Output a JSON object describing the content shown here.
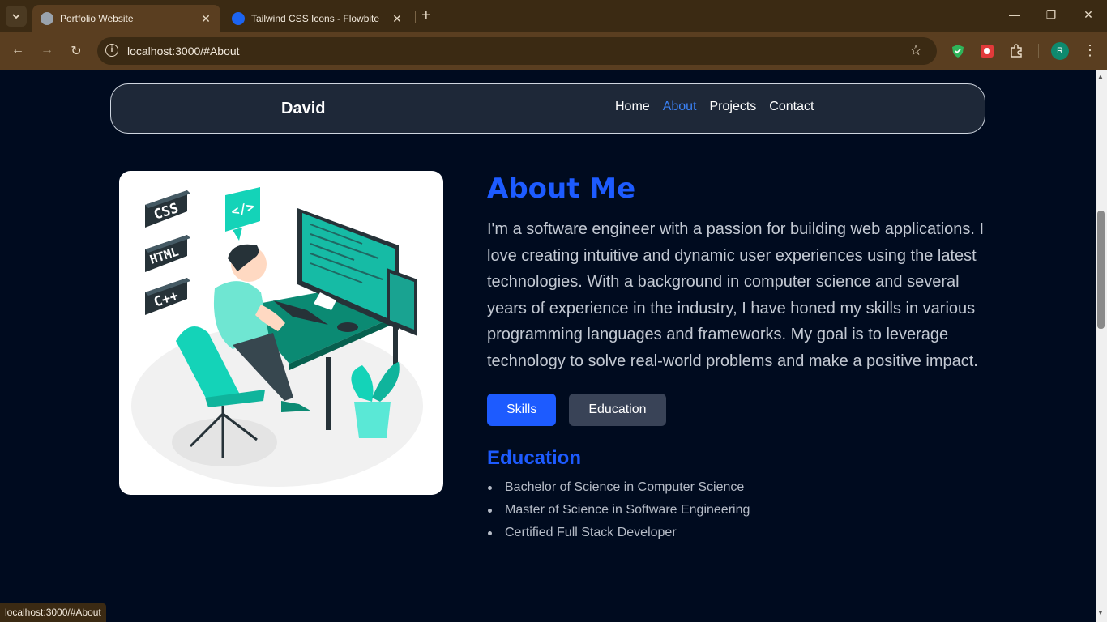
{
  "browser": {
    "tabs": [
      {
        "title": "Portfolio Website",
        "active": true
      },
      {
        "title": "Tailwind CSS Icons - Flowbite",
        "active": false
      }
    ],
    "address": "localhost:3000/#About",
    "status_url": "localhost:3000/#About",
    "profile_initial": "R"
  },
  "navbar": {
    "brand": "David",
    "links": [
      {
        "label": "Home",
        "active": false
      },
      {
        "label": "About",
        "active": true
      },
      {
        "label": "Projects",
        "active": false
      },
      {
        "label": "Contact",
        "active": false
      }
    ]
  },
  "about": {
    "title": "About Me",
    "description": "I'm a software engineer with a passion for building web applications. I love creating intuitive and dynamic user experiences using the latest technologies. With a background in computer science and several years of experience in the industry, I have honed my skills in various programming languages and frameworks. My goal is to leverage technology to solve real-world problems and make a positive impact.",
    "tabs": [
      {
        "label": "Skills",
        "active": true
      },
      {
        "label": "Education",
        "active": false
      }
    ],
    "section_title": "Education",
    "items": [
      "Bachelor of Science in Computer Science",
      "Master of Science in Software Engineering",
      "Certified Full Stack Developer"
    ]
  },
  "illustration": {
    "labels": [
      "CSS",
      "HTML",
      "C++",
      "</>"
    ]
  },
  "colors": {
    "accent": "#1d5bff",
    "page_bg": "#000b1f",
    "teal": "#14d3b8"
  }
}
